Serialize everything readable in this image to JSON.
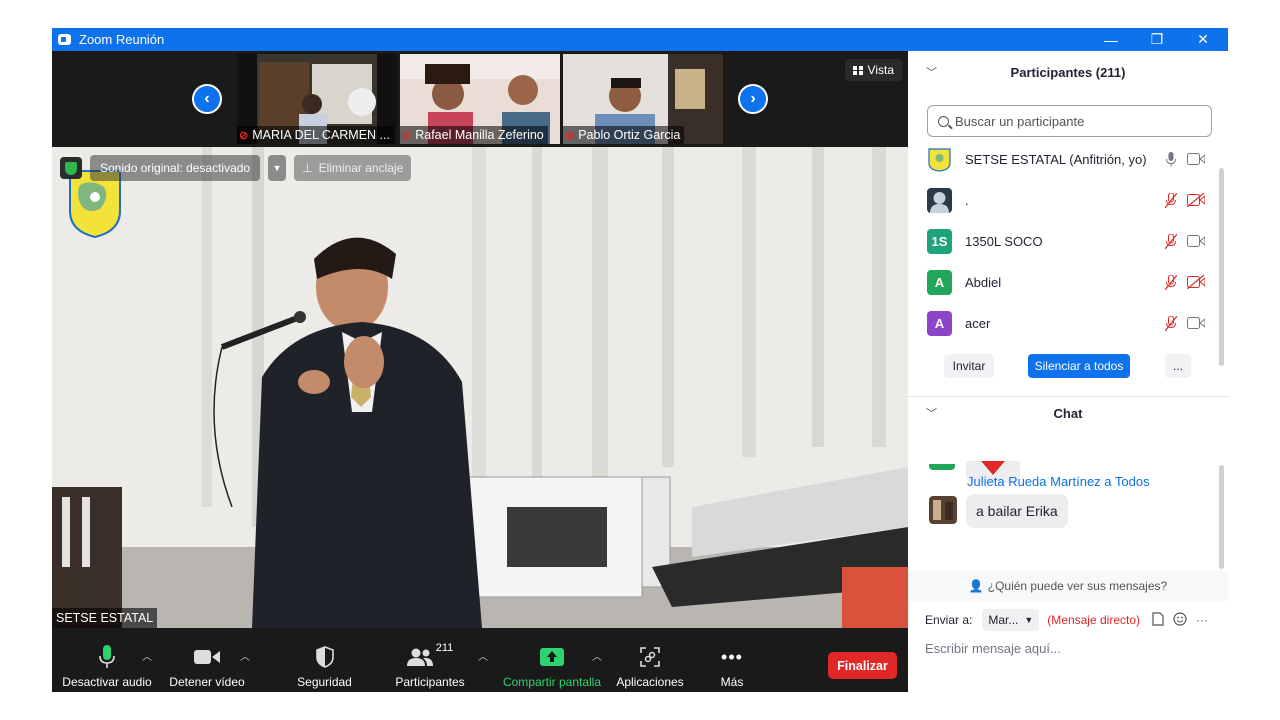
{
  "window": {
    "title": "Zoom Reunión",
    "minimize_glyph": "—",
    "restore_glyph": "❐",
    "close_glyph": "✕"
  },
  "strip": {
    "prev_glyph": "‹",
    "next_glyph": "›",
    "view_label": "Vista",
    "thumbnails": [
      {
        "name": "MARIA DEL CARMEN ...",
        "muted": true
      },
      {
        "name": "Rafael Manilla Zeferino",
        "muted": true
      },
      {
        "name": "Pablo Ortiz Garcia",
        "muted": true
      }
    ]
  },
  "main_video": {
    "original_sound": "Sonido original: desactivado",
    "unpin": "Eliminar anclaje",
    "speaker_name": "SETSE ESTATAL"
  },
  "toolbar": {
    "audio": "Desactivar audio",
    "video": "Detener vídeo",
    "security": "Seguridad",
    "participants": "Participantes",
    "participants_count": "211",
    "share": "Compartir pantalla",
    "apps": "Aplicaciones",
    "more": "Más",
    "end": "Finalizar"
  },
  "participants_panel": {
    "title": "Participantes (211)",
    "search_placeholder": "Buscar un participante",
    "items": [
      {
        "initials": "",
        "name": "SETSE ESTATAL (Anfitrión, yo)",
        "avatar_color": "#f5e642",
        "mic": "on",
        "cam": "off"
      },
      {
        "initials": "",
        "name": ".",
        "avatar_color": "#5a6a7a",
        "mic": "muted",
        "cam": "blocked"
      },
      {
        "initials": "1S",
        "name": "1350L SOCO",
        "avatar_color": "#1fa37a",
        "mic": "muted",
        "cam": "off"
      },
      {
        "initials": "A",
        "name": "Abdiel",
        "avatar_color": "#22a65a",
        "mic": "muted",
        "cam": "blocked"
      },
      {
        "initials": "A",
        "name": "acer",
        "avatar_color": "#8e44c9",
        "mic": "muted",
        "cam": "off"
      }
    ],
    "invite": "Invitar",
    "mute_all": "Silenciar a todos",
    "more": "..."
  },
  "chat_panel": {
    "title": "Chat",
    "message": {
      "author": "Julieta Rueda Martínez a Todos",
      "text": "a bailar Erika"
    },
    "who_can_see": "¿Quién puede ver sus mensajes?",
    "send_to_label": "Enviar a:",
    "send_to_value": "Mar...",
    "direct_message": "(Mensaje directo)",
    "input_placeholder": "Escribir mensaje aquí...",
    "more": "···"
  },
  "colors": {
    "accent": "#0e72ed",
    "danger": "#e02828",
    "share_green": "#2dd36f"
  }
}
